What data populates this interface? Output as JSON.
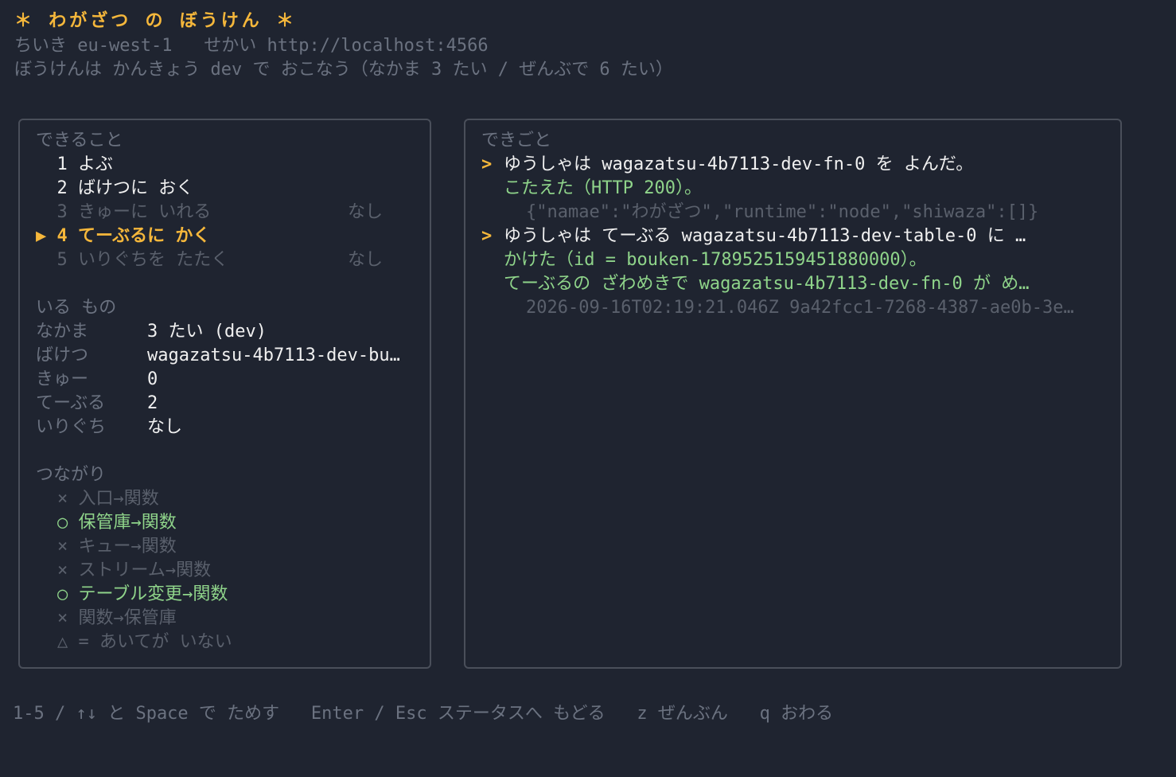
{
  "header": {
    "title": "＊ わがざつ の ぼうけん ＊",
    "region_label": "ちいき",
    "region_value": "eu-west-1",
    "world_label": "せかい",
    "world_value": "http://localhost:4566",
    "env_line": "ぼうけんは かんきょう dev で おこなう（なかま 3 たい / ぜんぶで 6 たい）"
  },
  "actions": {
    "heading": "できること",
    "items": [
      {
        "prefix": "  ",
        "label": "1 よぶ",
        "suffix": ""
      },
      {
        "prefix": "  ",
        "label": "2 ばけつに おく",
        "suffix": ""
      },
      {
        "prefix": "  ",
        "label": "3 きゅーに いれる",
        "suffix": "なし"
      },
      {
        "prefix": "▶ ",
        "label": "4 てーぶるに かく",
        "suffix": ""
      },
      {
        "prefix": "  ",
        "label": "5 いりぐちを たたく",
        "suffix": "なし"
      }
    ]
  },
  "resources": {
    "heading": "いる もの",
    "rows": [
      {
        "key": "なかま",
        "value": "3 たい (dev)"
      },
      {
        "key": "ばけつ",
        "value": "wagazatsu-4b7113-dev-bu…"
      },
      {
        "key": "きゅー",
        "value": "0"
      },
      {
        "key": "てーぶる",
        "value": "2"
      },
      {
        "key": "いりぐち",
        "value": "なし"
      }
    ]
  },
  "connections": {
    "heading": "つながり",
    "items": [
      {
        "mark": "×",
        "label": "入口→関数",
        "state": "off"
      },
      {
        "mark": "○",
        "label": "保管庫→関数",
        "state": "on"
      },
      {
        "mark": "×",
        "label": "キュー→関数",
        "state": "off"
      },
      {
        "mark": "×",
        "label": "ストリーム→関数",
        "state": "off"
      },
      {
        "mark": "○",
        "label": "テーブル変更→関数",
        "state": "on"
      },
      {
        "mark": "×",
        "label": "関数→保管庫",
        "state": "off"
      },
      {
        "mark": "△",
        "label": "= あいてが いない",
        "state": "off"
      }
    ]
  },
  "events": {
    "heading": "できごと",
    "lines": [
      {
        "type": "prompt",
        "marker": ">",
        "text": "ゆうしゃは wagazatsu-4b7113-dev-fn-0 を よんだ。"
      },
      {
        "type": "ok",
        "text": "こたえた（HTTP 200）。"
      },
      {
        "type": "detail",
        "text": "{\"namae\":\"わがざつ\",\"runtime\":\"node\",\"shiwaza\":[]}"
      },
      {
        "type": "prompt",
        "marker": ">",
        "text": "ゆうしゃは てーぶる wagazatsu-4b7113-dev-table-0 に …"
      },
      {
        "type": "ok",
        "text": "かけた（id = bouken-1789525159451880000）。"
      },
      {
        "type": "ok",
        "text": "てーぶるの ざわめきで wagazatsu-4b7113-dev-fn-0 が め…"
      },
      {
        "type": "detail",
        "text": "2026-09-16T02:19:21.046Z 9a42fcc1-7268-4387-ae0b-3e…"
      }
    ]
  },
  "footer": {
    "hint": "1-5 / ↑↓ と Space で ためす   Enter / Esc ステータスへ もどる   z ぜんぶん   q おわる"
  },
  "colors": {
    "background": "#1f2430",
    "accent": "#f5b73b",
    "success": "#8fd48a",
    "muted": "#6b7280"
  }
}
